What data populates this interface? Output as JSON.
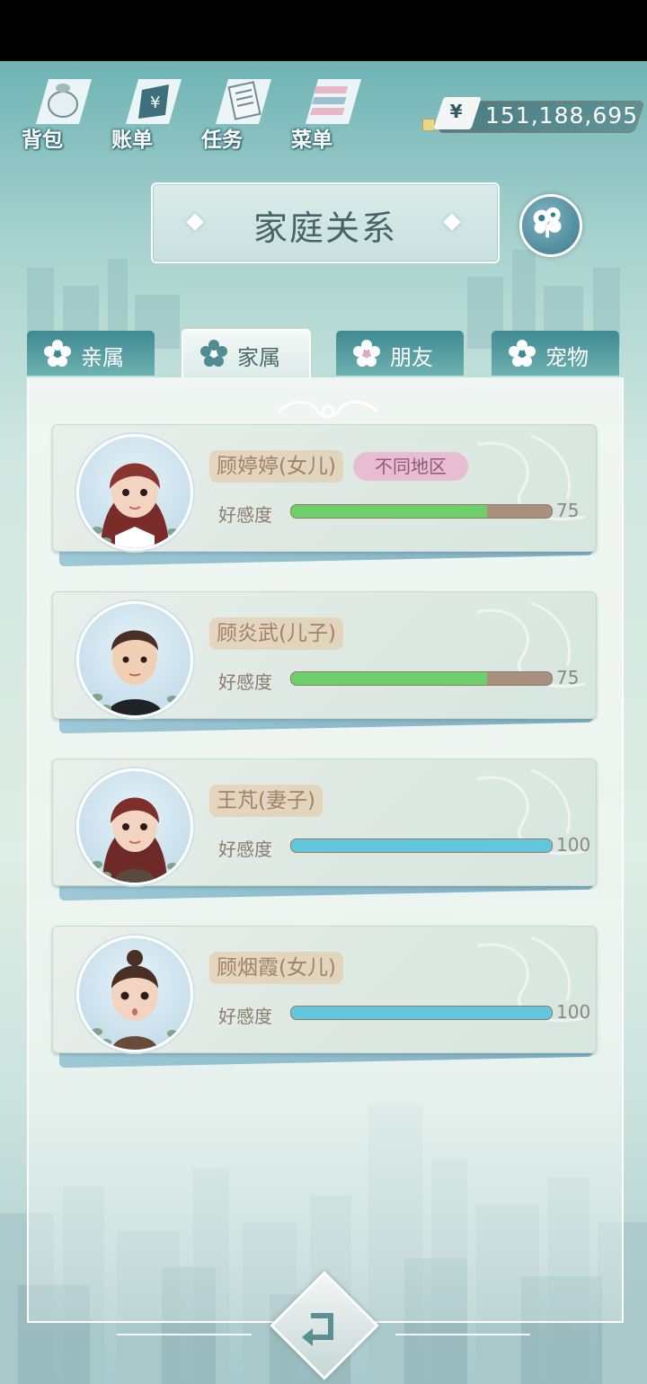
{
  "toolbar": [
    {
      "label": "背包",
      "icon": "bag-icon"
    },
    {
      "label": "账单",
      "icon": "bill-icon"
    },
    {
      "label": "任务",
      "icon": "task-icon"
    },
    {
      "label": "菜单",
      "icon": "menu-icon"
    }
  ],
  "money": {
    "currency_symbol": "¥",
    "amount": "151,188,695"
  },
  "title": "家庭关系",
  "tabs": [
    {
      "label": "亲属",
      "active": false
    },
    {
      "label": "家属",
      "active": true
    },
    {
      "label": "朋友",
      "active": false
    },
    {
      "label": "宠物",
      "active": false
    }
  ],
  "members": [
    {
      "name": "顾婷婷(女儿)",
      "tag": "不同地区",
      "affection_label": "好感度",
      "affection": 75,
      "bar_color": "green"
    },
    {
      "name": "顾炎武(儿子)",
      "affection_label": "好感度",
      "affection": 75,
      "bar_color": "green"
    },
    {
      "name": "王芃(妻子)",
      "affection_label": "好感度",
      "affection": 100,
      "bar_color": "blue"
    },
    {
      "name": "顾烟霞(女儿)",
      "affection_label": "好感度",
      "affection": 100,
      "bar_color": "blue"
    }
  ],
  "colors": {
    "accent": "#3f8a92",
    "green_bar": "#6fcf6a",
    "blue_bar": "#63c6dd",
    "tag_pink": "#e8bdd2"
  }
}
